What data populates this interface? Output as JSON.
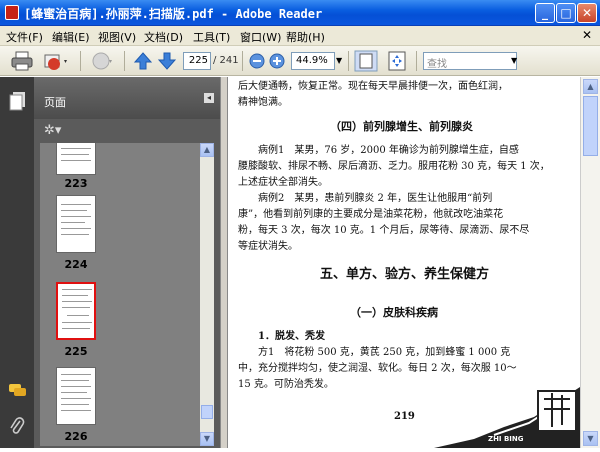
{
  "window": {
    "title": "[蜂蜜治百病].孙丽萍.扫描版.pdf - Adobe Reader",
    "minimize": "_",
    "maximize": "□",
    "close": "✕"
  },
  "menu": [
    "文件(F)",
    "编辑(E)",
    "视图(V)",
    "文档(D)",
    "工具(T)",
    "窗口(W)",
    "帮助(H)"
  ],
  "menu_close": "✕",
  "toolbar": {
    "page_current": "225",
    "page_total": "/ 241",
    "zoom": "44.9%",
    "find_placeholder": "查找"
  },
  "panel": {
    "title": "页面",
    "collapse": "◂",
    "options_icon": "✲▾"
  },
  "thumbnails": [
    {
      "label": "223",
      "selected": false
    },
    {
      "label": "224",
      "selected": false
    },
    {
      "label": "225",
      "selected": true
    },
    {
      "label": "226",
      "selected": false
    }
  ],
  "document": {
    "lines": [
      "后大便通畅，恢复正常。现在每天早晨排便一次，面色红润，",
      "精神饱满。",
      "（四）前列腺增生、前列腺炎",
      "病例1　某男，76 岁，2000 年确诊为前列腺增生症，自感",
      "腰膝酸软、排尿不畅、尿后滴沥、乏力。服用花粉 30 克，每天 1 次，",
      "上述症状全部消失。",
      "病例2　某男，患前列腺炎 2 年，医生让他服用“前列",
      "康”，他看到前列康的主要成分是油菜花粉，他就改吃油菜花",
      "粉，每天 3 次，每次 10 克。1 个月后，尿等待、尿滴沥、尿不尽",
      "等症状消失。",
      "五、单方、验方、养生保健方",
      "（一）皮肤科疾病",
      "1．脱发、秃发",
      "方1　将花粉 500 克，黄芪 250 克，加到蜂蜜 1 000 克",
      "中，充分搅拌均匀，使之润湿、软化。每日 2 次，每次服 10～",
      "15 克。可防治秃发。",
      "219"
    ],
    "stamp_text": "ZHI BING"
  },
  "colors": {
    "titlebar": "#0a5ee0",
    "selected_border": "#e01010",
    "panel_bg": "#5b5b5b"
  }
}
